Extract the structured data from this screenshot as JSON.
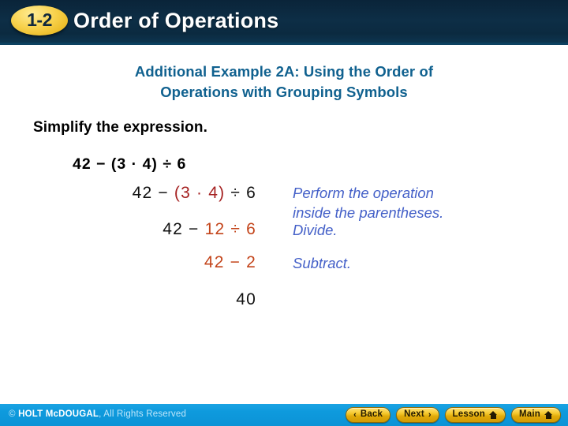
{
  "header": {
    "badge": "1-2",
    "title": "Order of Operations"
  },
  "content": {
    "example_heading_line1": "Additional Example 2A: Using the Order of",
    "example_heading_line2": "Operations with Grouping Symbols",
    "instruction": "Simplify the expression.",
    "problem": "42 − (3 · 4) ÷ 6",
    "work_rows": [
      {
        "segments": [
          {
            "text": "42 − ",
            "color_role": "black"
          },
          {
            "text": "(3 · 4)",
            "color_role": "darkred"
          },
          {
            "text": " ÷ 6",
            "color_role": "black"
          }
        ],
        "note": "Perform the operation\ninside the parentheses.",
        "note_line1": "Perform the operation",
        "note_line2": "inside the parentheses."
      },
      {
        "segments": [
          {
            "text": "42 − ",
            "color_role": "black"
          },
          {
            "text": "12 ÷ 6",
            "color_role": "orange"
          }
        ],
        "note_line1": "Divide.",
        "note_line2": ""
      },
      {
        "segments": [
          {
            "text": "42 − 2",
            "color_role": "orange"
          }
        ],
        "note_line1": "Subtract.",
        "note_line2": ""
      },
      {
        "segments": [
          {
            "text": "40",
            "color_role": "black"
          }
        ],
        "note_line1": "",
        "note_line2": ""
      }
    ]
  },
  "footer": {
    "copyright_mark": "© ",
    "copyright_brand": "HOLT McDOUGAL",
    "copyright_rest": ", All Rights Reserved",
    "buttons": [
      {
        "label": "Back",
        "icon": "chevron-left-icon",
        "glyph": "‹",
        "icon_side": "left"
      },
      {
        "label": "Next",
        "icon": "chevron-right-icon",
        "glyph": "›",
        "icon_side": "right"
      },
      {
        "label": "Lesson",
        "icon": "home-icon",
        "glyph": "home",
        "icon_side": "right"
      },
      {
        "label": "Main",
        "icon": "home-icon",
        "glyph": "home",
        "icon_side": "right"
      }
    ]
  },
  "colors": {
    "header_bg": "#0b2a40",
    "badge_gold": "#f8d24d",
    "heading_blue": "#10618f",
    "note_blue": "#4460c8",
    "dark_red": "#A52121",
    "orange_red": "#C3441A",
    "footer_blue": "#0e9add",
    "button_gold": "#f6c92f"
  }
}
